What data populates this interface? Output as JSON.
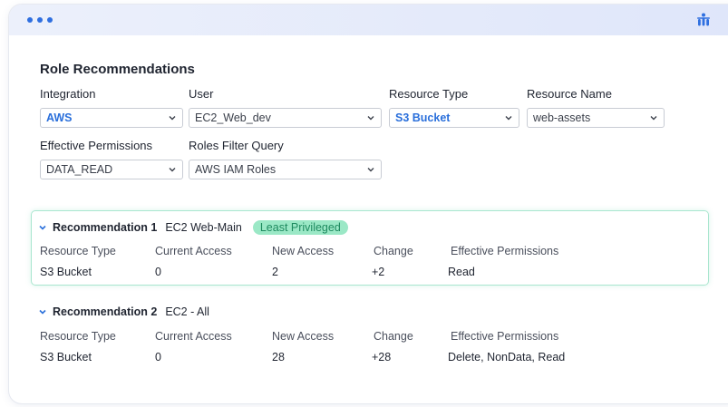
{
  "page": {
    "title": "Role Recommendations"
  },
  "filters": {
    "integration": {
      "label": "Integration",
      "value": "AWS"
    },
    "user": {
      "label": "User",
      "value": "EC2_Web_dev"
    },
    "resource_type": {
      "label": "Resource Type",
      "value": "S3 Bucket"
    },
    "resource_name": {
      "label": "Resource Name",
      "value": "web-assets"
    },
    "effective_permissions": {
      "label": "Effective Permissions",
      "value": "DATA_READ"
    },
    "roles_filter_query": {
      "label": "Roles Filter Query",
      "value": "AWS IAM Roles"
    }
  },
  "columns": [
    "Resource Type",
    "Current Access",
    "New Access",
    "Change",
    "Effective Permissions"
  ],
  "recommendations": [
    {
      "name": "Recommendation 1",
      "role": "EC2 Web-Main",
      "badge": "Least Privileged",
      "row": [
        "S3 Bucket",
        "0",
        "2",
        "+2",
        "Read"
      ]
    },
    {
      "name": "Recommendation 2",
      "role": "EC2 - All",
      "row": [
        "S3 Bucket",
        "0",
        "28",
        "+28",
        "Delete, NonData, Read"
      ]
    }
  ],
  "icons": {
    "window_dots": "window-dots-icon",
    "logo": "brand-logo-icon",
    "dropdown": "chevron-down-icon",
    "expand": "caret-down-icon"
  },
  "colors": {
    "accent": "#2a6fdb",
    "badge_bg": "#9be8c6",
    "badge_text": "#1e8a5f",
    "card_border": "#a9e6cf"
  }
}
